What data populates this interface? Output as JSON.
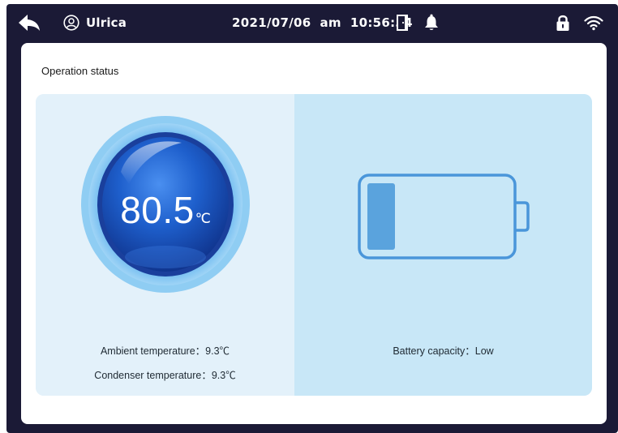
{
  "topbar": {
    "back_icon": "back-arrow-icon",
    "user_icon": "user-icon",
    "user_name": "Ulrica",
    "datetime": "2021/07/06  am  10:56:34",
    "door_icon": "door-icon",
    "bell_icon": "bell-icon",
    "lock_icon": "lock-icon",
    "wifi_icon": "wifi-icon"
  },
  "panel": {
    "title": "Operation status"
  },
  "temperature": {
    "value": "80.5",
    "unit": "℃",
    "ambient_label": "Ambient temperature：9.3℃",
    "condenser_label": "Condenser temperature：9.3℃"
  },
  "battery": {
    "label": "Battery capacity：Low",
    "level_fraction": 0.2
  },
  "colors": {
    "topbar_bg": "#1b1a36",
    "left_pane_bg": "#e3f1fa",
    "right_pane_bg": "#c8e7f7",
    "gauge_blue": "#1f6fd0",
    "battery_outline": "#4a96da",
    "battery_fill": "#5aa3dd"
  }
}
